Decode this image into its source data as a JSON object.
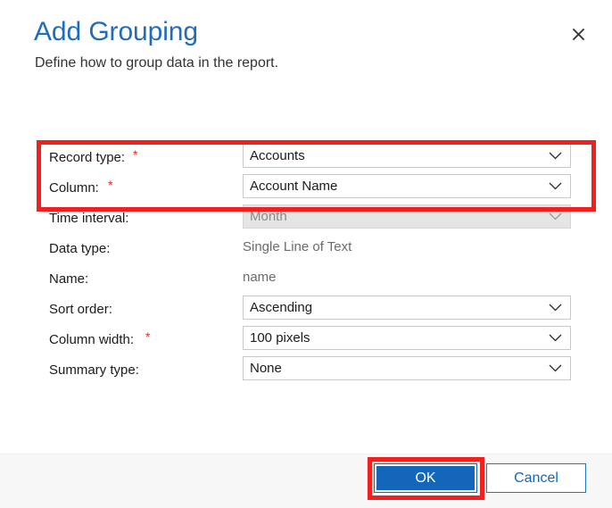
{
  "dialog": {
    "title": "Add Grouping",
    "subtitle": "Define how to group data in the report.",
    "close_icon": "close-icon",
    "accent_color": "#1f6cbd",
    "required_marker": "*",
    "annotation_color": "#f21f1f"
  },
  "form": {
    "rows": [
      {
        "label": "Record type:",
        "required": true,
        "control": "select",
        "value": "Accounts",
        "disabled": false
      },
      {
        "label": "Column:",
        "required": true,
        "control": "select",
        "value": "Account Name",
        "disabled": false
      },
      {
        "label": "Time interval:",
        "required": false,
        "control": "select",
        "value": "Month",
        "disabled": true
      },
      {
        "label": "Data type:",
        "required": false,
        "control": "text",
        "value": "Single Line of Text",
        "disabled": false
      },
      {
        "label": "Name:",
        "required": false,
        "control": "text",
        "value": "name",
        "disabled": false
      },
      {
        "label": "Sort order:",
        "required": false,
        "control": "select",
        "value": "Ascending",
        "disabled": false
      },
      {
        "label": "Column width:",
        "required": true,
        "control": "select",
        "value": "100 pixels",
        "disabled": false
      },
      {
        "label": "Summary type:",
        "required": false,
        "control": "select",
        "value": "None",
        "disabled": false
      }
    ]
  },
  "footer": {
    "ok_label": "OK",
    "cancel_label": "Cancel"
  }
}
